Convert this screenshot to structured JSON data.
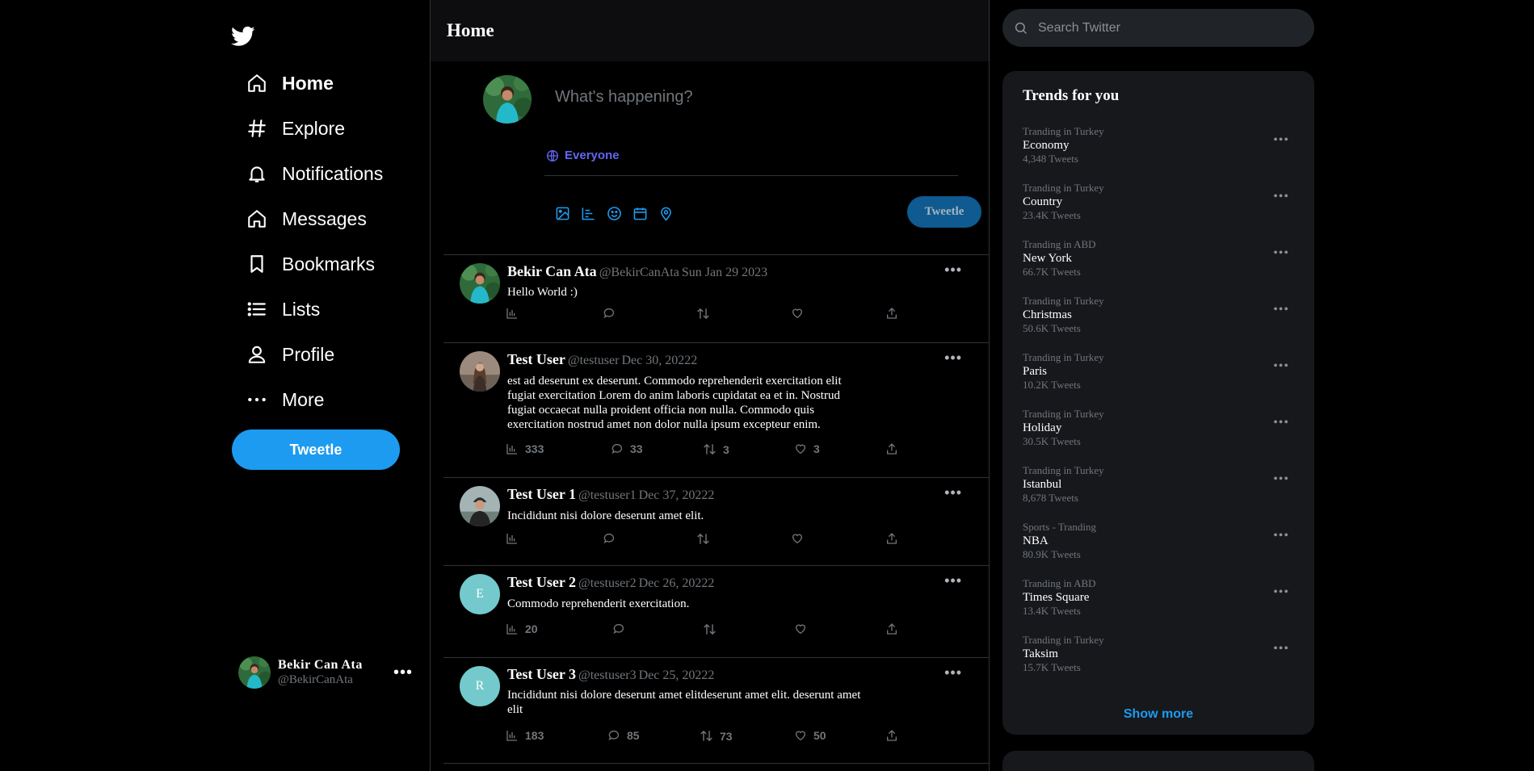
{
  "colors": {
    "accent": "#1d9bf0",
    "audience": "#6366f1",
    "muted": "#71767b",
    "background": "#000000",
    "card": "#16181c"
  },
  "sidebar": {
    "logo": "twitter-bird-icon",
    "nav": [
      {
        "label": "Home",
        "icon": "home-icon",
        "active": true
      },
      {
        "label": "Explore",
        "icon": "hashtag-icon"
      },
      {
        "label": "Notifications",
        "icon": "bell-icon"
      },
      {
        "label": "Messages",
        "icon": "home-icon"
      },
      {
        "label": "Bookmarks",
        "icon": "bookmark-icon"
      },
      {
        "label": "Lists",
        "icon": "list-icon"
      },
      {
        "label": "Profile",
        "icon": "user-icon"
      },
      {
        "label": "More",
        "icon": "more-dots-icon"
      }
    ],
    "tweet_button": "Tweetle",
    "account": {
      "display_name": "Bekir Can Ata",
      "handle": "@BekirCanAta"
    }
  },
  "main": {
    "title": "Home",
    "composer": {
      "placeholder": "What's happening?",
      "audience": "Everyone",
      "tools": [
        "image-icon",
        "poll-icon",
        "emoji-icon",
        "schedule-icon",
        "location-icon"
      ],
      "tweet_button": "Tweetle"
    },
    "tweets": [
      {
        "name": "Bekir Can Ata",
        "handle": "@BekirCanAta",
        "date": "Sun Jan 29 2023",
        "text": "Hello World :)",
        "views": "",
        "replies": "",
        "retweets": "",
        "likes": ""
      },
      {
        "name": "Test User",
        "handle": "@testuser",
        "date": "Dec 30, 20222",
        "text": "est ad deserunt ex deserunt. Commodo reprehenderit exercitation elit fugiat exercitation Lorem do anim laboris cupidatat ea et in. Nostrud fugiat occaecat nulla proident officia non nulla. Commodo quis exercitation nostrud amet non dolor nulla ipsum excepteur enim.",
        "views": "333",
        "replies": "33",
        "retweets": "3",
        "likes": "3"
      },
      {
        "name": "Test User 1",
        "handle": "@testuser1",
        "date": "Dec 37, 20222",
        "text": "Incididunt nisi dolore deserunt amet elit.",
        "views": "",
        "replies": "",
        "retweets": "",
        "likes": ""
      },
      {
        "name": "Test User 2",
        "handle": "@testuser2",
        "date": "Dec 26, 20222",
        "text": "Commodo reprehenderit exercitation.",
        "avatar_letter": "E",
        "views": "20",
        "replies": "",
        "retweets": "",
        "likes": ""
      },
      {
        "name": "Test User 3",
        "handle": "@testuser3",
        "date": "Dec 25, 20222",
        "text": "Incididunt nisi dolore deserunt amet elitdeserunt amet elit. deserunt amet elit",
        "avatar_letter": "R",
        "views": "183",
        "replies": "85",
        "retweets": "73",
        "likes": "50"
      }
    ]
  },
  "search": {
    "placeholder": "Search Twitter"
  },
  "trends": {
    "title": "Trends for you",
    "items": [
      {
        "category": "Tranding in Turkey",
        "name": "Economy",
        "count": "4,348 Tweets"
      },
      {
        "category": "Tranding in Turkey",
        "name": "Country",
        "count": "23.4K Tweets"
      },
      {
        "category": "Tranding in ABD",
        "name": "New York",
        "count": "66.7K Tweets"
      },
      {
        "category": "Tranding in Turkey",
        "name": "Christmas",
        "count": "50.6K Tweets"
      },
      {
        "category": "Tranding in Turkey",
        "name": "Paris",
        "count": "10.2K Tweets"
      },
      {
        "category": "Tranding in Turkey",
        "name": "Holiday",
        "count": "30.5K Tweets"
      },
      {
        "category": "Tranding in Turkey",
        "name": "Istanbul",
        "count": "8,678 Tweets"
      },
      {
        "category": "Sports - Tranding",
        "name": "NBA",
        "count": "80.9K Tweets"
      },
      {
        "category": "Tranding in ABD",
        "name": "Times Square",
        "count": "13.4K Tweets"
      },
      {
        "category": "Tranding in Turkey",
        "name": "Taksim",
        "count": "15.7K Tweets"
      }
    ],
    "show_more": "Show more"
  }
}
